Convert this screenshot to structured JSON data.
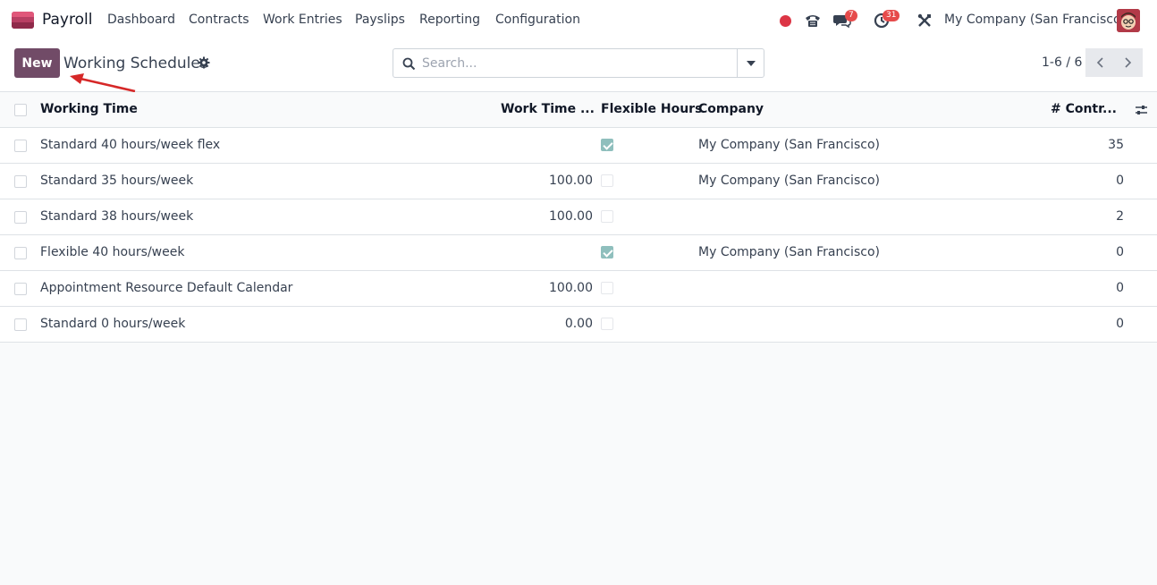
{
  "app": {
    "name": "Payroll",
    "brand_color": "#714b67"
  },
  "nav": [
    "Dashboard",
    "Contracts",
    "Work Entries",
    "Payslips",
    "Reporting",
    "Configuration"
  ],
  "systray": {
    "messages_badge": "7",
    "activities_badge": "31",
    "company": "My Company (San Francisco)",
    "icons": [
      "recording-dot-icon",
      "phone-icon",
      "chat-icon",
      "clock-icon",
      "tools-icon",
      "avatar"
    ]
  },
  "control": {
    "new_label": "New",
    "title": "Working Schedules",
    "search_placeholder": "Search...",
    "pager": "1-6 / 6"
  },
  "table": {
    "headers": {
      "name": "Working Time",
      "work_time": "Work Time ...",
      "flexible": "Flexible Hours",
      "company": "Company",
      "contracts": "# Contr..."
    },
    "rows": [
      {
        "name": "Standard 40 hours/week flex",
        "work_time": "",
        "flexible": true,
        "company": "My Company (San Francisco)",
        "contracts": "35"
      },
      {
        "name": "Standard 35 hours/week",
        "work_time": "100.00",
        "flexible": false,
        "company": "My Company (San Francisco)",
        "contracts": "0"
      },
      {
        "name": "Standard 38 hours/week",
        "work_time": "100.00",
        "flexible": false,
        "company": "",
        "contracts": "2"
      },
      {
        "name": "Flexible 40 hours/week",
        "work_time": "",
        "flexible": true,
        "company": "My Company (San Francisco)",
        "contracts": "0"
      },
      {
        "name": "Appointment Resource Default Calendar",
        "work_time": "100.00",
        "flexible": false,
        "company": "",
        "contracts": "0"
      },
      {
        "name": "Standard 0 hours/week",
        "work_time": "0.00",
        "flexible": false,
        "company": "",
        "contracts": "0"
      }
    ]
  }
}
